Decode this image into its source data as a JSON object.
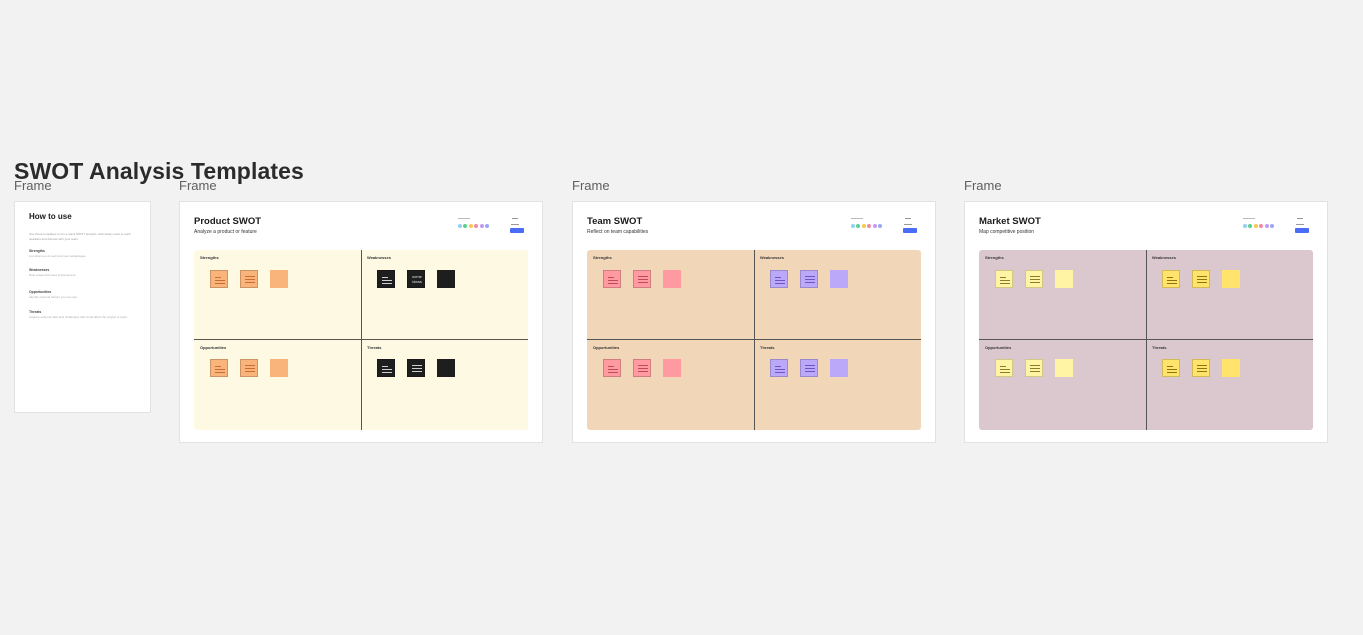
{
  "board": {
    "title": "SWOT Analysis Templates"
  },
  "frame_labels": [
    "Frame",
    "Frame",
    "Frame",
    "Frame"
  ],
  "howto": {
    "title": "How to use",
    "intro": "Use these templates to run a quick SWOT analysis. Add sticky notes to each quadrant and discuss with your team.",
    "sections": [
      {
        "heading": "Strengths",
        "body": "List what you do well and your advantages."
      },
      {
        "heading": "Weaknesses",
        "body": "Note areas that need improvement."
      },
      {
        "heading": "Opportunities",
        "body": "Identify external factors you can use."
      },
      {
        "heading": "Threats",
        "body": "Capture external risks and challenges that could affect the project or team."
      }
    ]
  },
  "swots": [
    {
      "title": "Product SWOT",
      "subtitle": "Analyze a product or feature",
      "bg": "#fdf9e3",
      "quadrants": [
        {
          "label": "Strengths",
          "note_color": "#f9b47c",
          "line_color": "#c86c31"
        },
        {
          "label": "Weaknesses",
          "note_color": "#1e1e1e",
          "line_color": "#cfcfcf",
          "middle_text": "some ideas"
        },
        {
          "label": "Opportunities",
          "note_color": "#f9b47c",
          "line_color": "#c86c31"
        },
        {
          "label": "Threats",
          "note_color": "#1e1e1e",
          "line_color": "#cfcfcf"
        }
      ]
    },
    {
      "title": "Team SWOT",
      "subtitle": "Reflect on team capabilities",
      "bg": "#f2d6b8",
      "quadrants": [
        {
          "label": "Strengths",
          "note_color": "#ff9aa0",
          "line_color": "#c04a55"
        },
        {
          "label": "Weaknesses",
          "note_color": "#bca8f8",
          "line_color": "#6b55c9"
        },
        {
          "label": "Opportunities",
          "note_color": "#ff9aa0",
          "line_color": "#c04a55"
        },
        {
          "label": "Threats",
          "note_color": "#bca8f8",
          "line_color": "#6b55c9"
        }
      ]
    },
    {
      "title": "Market SWOT",
      "subtitle": "Map competitive position",
      "bg": "#dbc8cf",
      "quadrants": [
        {
          "label": "Strengths",
          "note_color": "#fff4a3",
          "line_color": "#8a7d2a"
        },
        {
          "label": "Weaknesses",
          "note_color": "#ffe36b",
          "line_color": "#8a7410"
        },
        {
          "label": "Opportunities",
          "note_color": "#fff4a3",
          "line_color": "#8a7d2a"
        },
        {
          "label": "Threats",
          "note_color": "#ffe36b",
          "line_color": "#8a7410"
        }
      ]
    }
  ],
  "avatar_colors": [
    "#8fd3f2",
    "#5ccf8e",
    "#f7c94b",
    "#f08aa8",
    "#c59af0",
    "#9aa7f5"
  ]
}
